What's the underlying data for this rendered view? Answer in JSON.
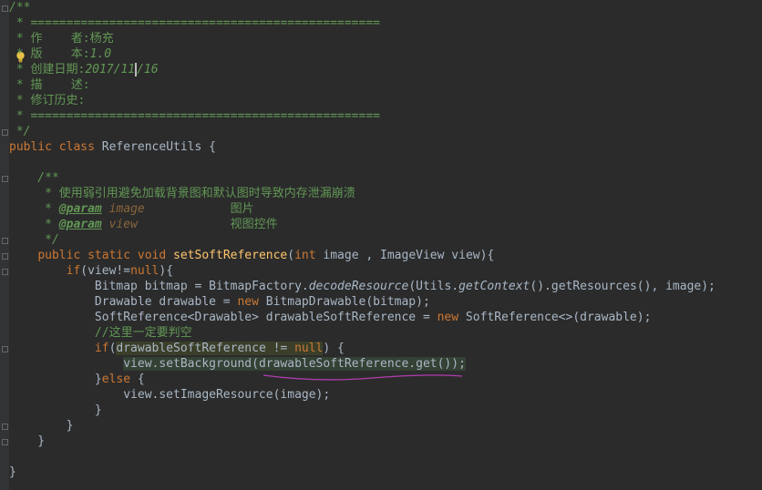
{
  "lines": [
    "/**",
    " * =================================================",
    " * 作    者:杨充",
    " * 版    本:1.0",
    " * 创建日期:2017/11/16",
    " * 描    述:",
    " * 修订历史:",
    " * =================================================",
    " */",
    "public class ReferenceUtils {",
    "",
    "    /**",
    "     * 使用弱引用避免加载背景图和默认图时导致内存泄漏崩溃",
    "     * @param image            图片",
    "     * @param view             视图控件",
    "     */",
    "    public static void setSoftReference(int image , ImageView view){",
    "        if(view!=null){",
    "            Bitmap bitmap = BitmapFactory.decodeResource(Utils.getContext().getResources(), image);",
    "            Drawable drawable = new BitmapDrawable(bitmap);",
    "            SoftReference<Drawable> drawableSoftReference = new SoftReference<>(drawable);",
    "            //这里一定要判空",
    "            if(drawableSoftReference != null) {",
    "                view.setBackground(drawableSoftReference.get());",
    "            }else {",
    "                view.setImageResource(image);",
    "            }",
    "        }",
    "    }",
    "",
    "}"
  ],
  "tokens": {
    "c_author_label": "作    者:",
    "c_author_value": "杨充",
    "c_version_label": "版    本:",
    "c_version_value": "1.0",
    "c_date_label": "创建日期:",
    "c_date_value_a": "2017/11",
    "c_date_value_b": "/16",
    "c_desc_label": "描    述:",
    "c_history_label": "修订历史:",
    "c_rule": "=================================================",
    "class_decl_kw": "public class",
    "class_name": "ReferenceUtils {",
    "javadoc_desc": "使用弱引用避免加载背景图和默认图时导致内存泄漏崩溃",
    "param_tag": "@param",
    "param1_name": "image",
    "param1_desc": "图片",
    "param2_name": "view",
    "param2_desc": "视图控件",
    "method_mods": "public static void",
    "method_name": "setSoftReference",
    "int_kw": "int",
    "method_params": " image , ImageView view){",
    "if_kw": "if",
    "null_kw": "null",
    "new_kw": "new",
    "else_kw": "else",
    "line_comment": "//这里一定要判空"
  },
  "colors": {
    "background": "#2b2b2b",
    "gutter": "#313335",
    "text": "#a9b7c6",
    "keyword": "#cc7832",
    "comment": "#629755",
    "method": "#ffc66d",
    "squiggle": "#b03db0"
  }
}
